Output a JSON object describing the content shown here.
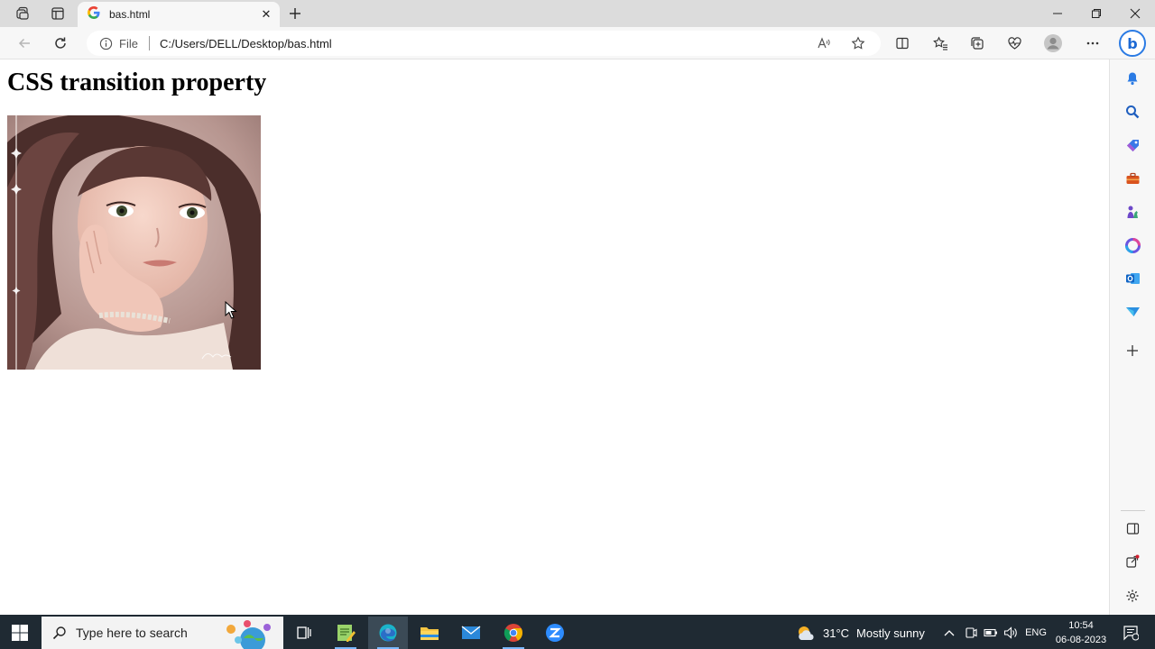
{
  "browser": {
    "tab": {
      "title": "bas.html",
      "close_glyph": "✕"
    },
    "address": {
      "scheme_label": "File",
      "url": "C:/Users/DELL/Desktop/bas.html"
    },
    "bing_glyph": "b"
  },
  "page": {
    "heading": "CSS transition property"
  },
  "taskbar": {
    "search_placeholder": "Type here to search",
    "weather": {
      "temperature": "31°C",
      "condition": "Mostly sunny"
    },
    "language": "ENG",
    "clock": {
      "time": "10:54",
      "date": "06-08-2023"
    }
  },
  "colors": {
    "accent": "#2b7be4",
    "taskbar": "#1f2a33",
    "chrome": "#f7f7f7"
  }
}
